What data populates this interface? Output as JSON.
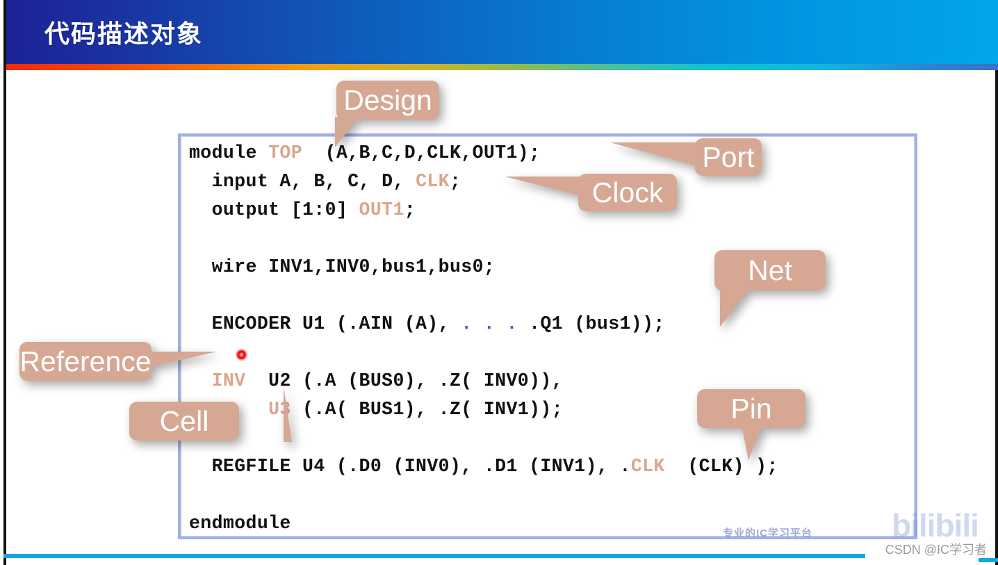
{
  "slide": {
    "title": "代码描述对象",
    "colors": {
      "header_gradient_start": "#1d2296",
      "header_gradient_end": "#02a6ea",
      "accent_bar_start": "#f32a0a",
      "accent_bar_end": "#3a72c8",
      "callout_fill": "#d6a894",
      "callout_text": "#ffffff",
      "code_box_border": "#9fb0e2",
      "code_text": "#111111",
      "code_highlight": "#dba68c",
      "code_dots": "#4a5fd0",
      "cursor_marker": "#e60000",
      "bottom_bar": "#15a7e0"
    }
  },
  "code": {
    "lines": [
      {
        "id": "line-module",
        "segments": [
          {
            "text": "module ",
            "style": "plain"
          },
          {
            "text": "TOP",
            "style": "highlight"
          },
          {
            "text": "  (A,B,C,D,CLK,OUT1);",
            "style": "plain"
          }
        ]
      },
      {
        "id": "line-input",
        "segments": [
          {
            "text": "  input A, B, C, D, ",
            "style": "plain"
          },
          {
            "text": "CLK",
            "style": "highlight"
          },
          {
            "text": ";",
            "style": "plain"
          }
        ]
      },
      {
        "id": "line-output",
        "segments": [
          {
            "text": "  output [1:0] ",
            "style": "plain"
          },
          {
            "text": "OUT1",
            "style": "highlight"
          },
          {
            "text": ";",
            "style": "plain"
          }
        ]
      },
      {
        "id": "line-blank-1",
        "segments": []
      },
      {
        "id": "line-wire",
        "segments": [
          {
            "text": "  wire INV1,INV0,bus1,bus0;",
            "style": "plain"
          }
        ]
      },
      {
        "id": "line-blank-2",
        "segments": []
      },
      {
        "id": "line-encoder",
        "segments": [
          {
            "text": "  ENCODER U1 (.AIN (A), ",
            "style": "plain"
          },
          {
            "text": ". . .",
            "style": "dots"
          },
          {
            "text": " .Q1 (bus1));",
            "style": "plain"
          }
        ]
      },
      {
        "id": "line-blank-3",
        "segments": []
      },
      {
        "id": "line-inv-u2",
        "segments": [
          {
            "text": "  ",
            "style": "plain"
          },
          {
            "text": "INV",
            "style": "highlight"
          },
          {
            "text": "  U2 (.A (BUS0), .Z( INV0)),",
            "style": "plain"
          }
        ]
      },
      {
        "id": "line-inv-u3",
        "segments": [
          {
            "text": "       ",
            "style": "plain"
          },
          {
            "text": "U3",
            "style": "highlight"
          },
          {
            "text": " (.A( BUS1), .Z( INV1));",
            "style": "plain"
          }
        ]
      },
      {
        "id": "line-blank-4",
        "segments": []
      },
      {
        "id": "line-regfile",
        "segments": [
          {
            "text": "  REGFILE U4 (.D0 (INV0), .D1 (INV1), .",
            "style": "plain"
          },
          {
            "text": "CLK",
            "style": "highlight"
          },
          {
            "text": "  (CLK) );",
            "style": "plain"
          }
        ]
      },
      {
        "id": "line-blank-5",
        "segments": []
      },
      {
        "id": "line-endmodule",
        "segments": [
          {
            "text": "endmodule",
            "style": "plain"
          }
        ]
      }
    ]
  },
  "callouts": {
    "design": {
      "label": "Design",
      "points_to": "TOP"
    },
    "port": {
      "label": "Port",
      "points_to": "(A,B,C,D,CLK,OUT1)"
    },
    "clock": {
      "label": "Clock",
      "points_to": "CLK"
    },
    "net": {
      "label": "Net",
      "points_to": "bus1"
    },
    "pin": {
      "label": "Pin",
      "points_to": ".CLK"
    },
    "reference": {
      "label": "Reference",
      "points_to": "INV"
    },
    "cell": {
      "label": "Cell",
      "points_to": "U3"
    }
  },
  "watermarks": {
    "bilibili": "bilibili",
    "faint_line": "专业的IC学习平台",
    "csdn": "CSDN @IC学习者"
  }
}
